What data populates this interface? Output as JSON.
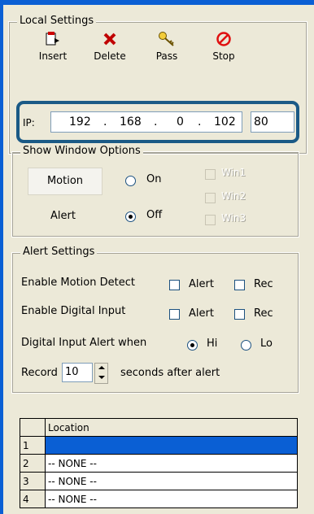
{
  "local_settings": {
    "title": "Local Settings",
    "toolbar": [
      {
        "label": "Insert",
        "icon": "insert-icon"
      },
      {
        "label": "Delete",
        "icon": "delete-icon"
      },
      {
        "label": "Pass",
        "icon": "key-icon"
      },
      {
        "label": "Stop",
        "icon": "stop-icon"
      }
    ],
    "ip_label": "IP:",
    "ip": [
      "192",
      "168",
      "0",
      "102"
    ],
    "ip_dot": ".",
    "port": "80"
  },
  "show_window_options": {
    "title": "Show Window Options",
    "motion_button": "Motion",
    "alert_label": "Alert",
    "radio_on": "On",
    "radio_off": "Off",
    "selected": "Off",
    "windows": [
      "Win1",
      "Win2",
      "Win3"
    ]
  },
  "alert_settings": {
    "title": "Alert Settings",
    "motion_detect_label": "Enable Motion Detect",
    "digital_input_label": "Enable Digital Input",
    "alert_label": "Alert",
    "rec_label": "Rec",
    "digital_alert_when_label": "Digital Input Alert when",
    "hi_label": "Hi",
    "lo_label": "Lo",
    "selected_level": "Hi",
    "record_label": "Record",
    "record_value": "10",
    "seconds_label": "seconds after alert"
  },
  "grid": {
    "header": "Location",
    "rows": [
      {
        "num": "1",
        "location": ""
      },
      {
        "num": "2",
        "location": "-- NONE --"
      },
      {
        "num": "3",
        "location": "-- NONE --"
      },
      {
        "num": "4",
        "location": "-- NONE --"
      }
    ]
  },
  "colors": {
    "accent": "#0a5fd4",
    "highlight_frame": "#1b5a86"
  }
}
